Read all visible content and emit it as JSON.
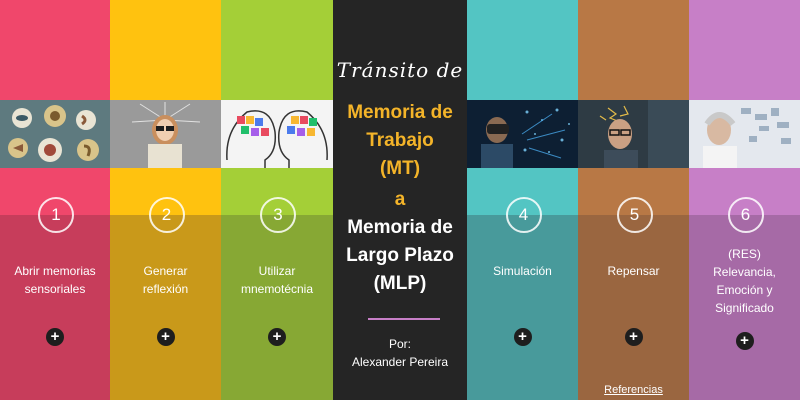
{
  "center": {
    "intro": "Tránsito de",
    "from_line1": "Memoria de",
    "from_line2": "Trabajo",
    "from_line3": "(MT)",
    "connector": "a",
    "to_line1": "Memoria de",
    "to_line2": "Largo Plazo",
    "to_line3": "(MLP)",
    "author_prefix": "Por:",
    "author": "Alexander Pereira"
  },
  "steps": [
    {
      "num": "1",
      "line1": "Abrir memorias",
      "line2": "sensoriales",
      "line3": "",
      "line4": "",
      "icon": "plus-icon"
    },
    {
      "num": "2",
      "line1": "Generar",
      "line2": "reflexión",
      "line3": "",
      "line4": "",
      "icon": "plus-icon"
    },
    {
      "num": "3",
      "line1": "Utilizar",
      "line2": "mnemotécnia",
      "line3": "",
      "line4": "",
      "icon": "plus-icon"
    },
    {
      "num": "4",
      "line1": "Simulación",
      "line2": "",
      "line3": "",
      "line4": "",
      "icon": "plus-icon"
    },
    {
      "num": "5",
      "line1": "Repensar",
      "line2": "",
      "line3": "",
      "line4": "",
      "icon": "plus-icon"
    },
    {
      "num": "6",
      "line1": "(RES)",
      "line2": "Relevancia,",
      "line3": "Emoción y",
      "line4": "Significado",
      "icon": "plus-icon"
    }
  ],
  "plus_symbol": "+",
  "references_link": "Referencias",
  "colors": {
    "col1": [
      "#f0476b",
      "#c73d5b"
    ],
    "col2": [
      "#ffc20f",
      "#c9991a"
    ],
    "col3": [
      "#a4cf37",
      "#87a834"
    ],
    "center": "#252525",
    "col4": [
      "#53c5c3",
      "#489a9b"
    ],
    "col5": [
      "#b87845",
      "#9a6640"
    ],
    "col6": [
      "#c77fc7",
      "#a66aa6"
    ],
    "accent_yellow": "#f4b429"
  }
}
